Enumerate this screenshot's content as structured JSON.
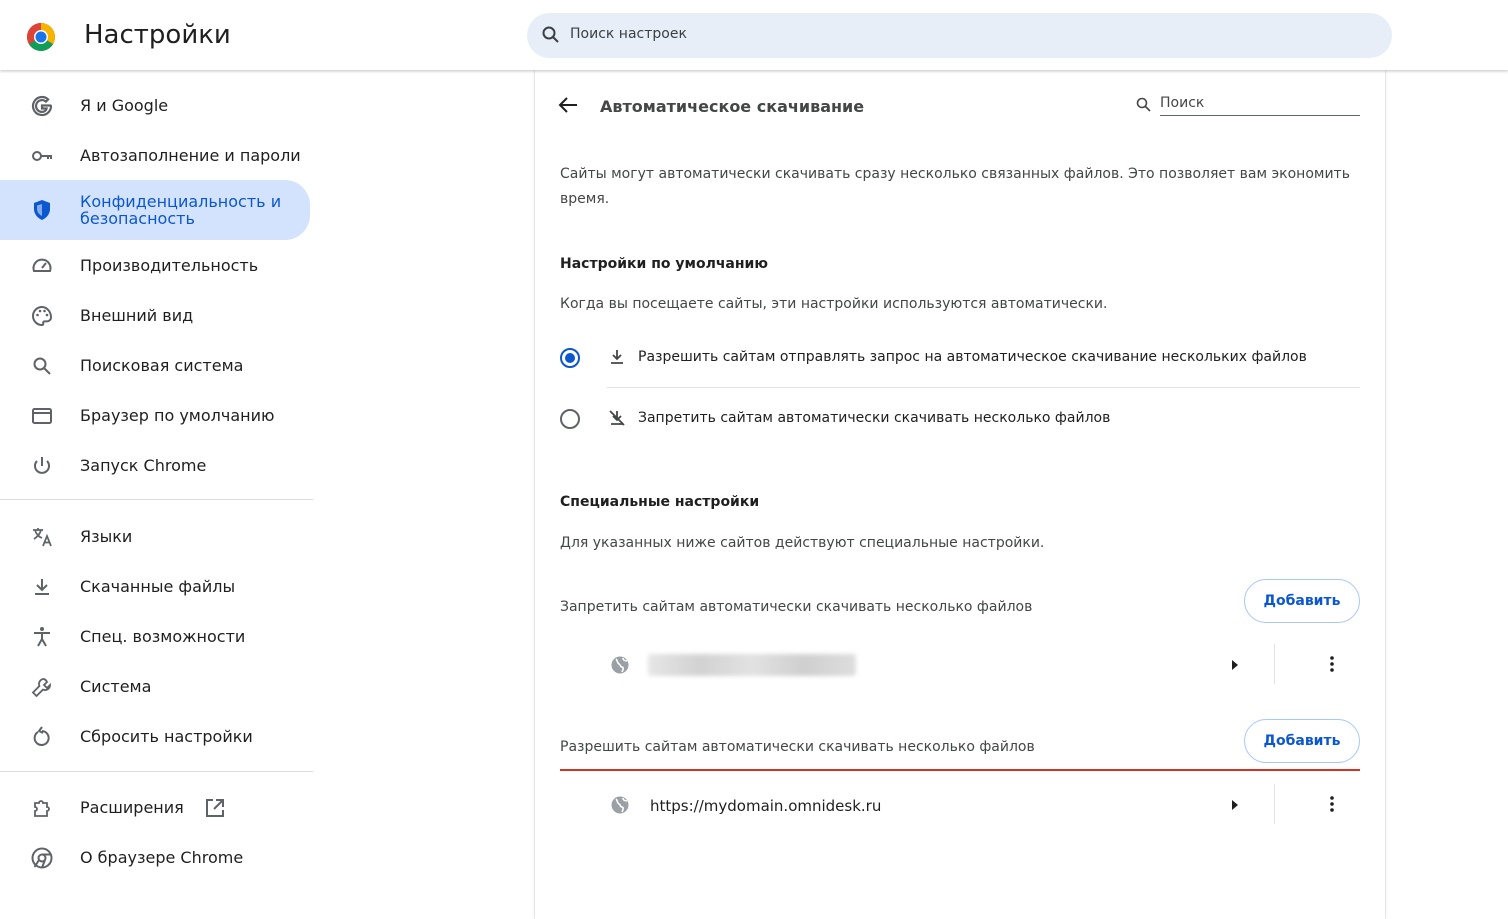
{
  "header": {
    "title": "Настройки",
    "search_placeholder": "Поиск настроек"
  },
  "sidebar": {
    "items": [
      {
        "label": "Я и Google",
        "icon": "google-icon"
      },
      {
        "label": "Автозаполнение и пароли",
        "icon": "key-icon"
      },
      {
        "label": "Конфиденциальность и безопасность",
        "icon": "shield-icon",
        "active": true
      },
      {
        "label": "Производительность",
        "icon": "speedometer-icon"
      },
      {
        "label": "Внешний вид",
        "icon": "palette-icon"
      },
      {
        "label": "Поисковая система",
        "icon": "search-icon"
      },
      {
        "label": "Браузер по умолчанию",
        "icon": "browser-window-icon"
      },
      {
        "label": "Запуск Chrome",
        "icon": "power-icon"
      },
      {
        "label": "Языки",
        "icon": "translate-icon"
      },
      {
        "label": "Скачанные файлы",
        "icon": "download-icon"
      },
      {
        "label": "Спец. возможности",
        "icon": "accessibility-icon"
      },
      {
        "label": "Система",
        "icon": "wrench-icon"
      },
      {
        "label": "Сбросить настройки",
        "icon": "reset-icon"
      },
      {
        "label": "Расширения",
        "icon": "puzzle-icon"
      },
      {
        "label": "О браузере Chrome",
        "icon": "chrome-icon"
      }
    ]
  },
  "page": {
    "title": "Автоматическое скачивание",
    "search_placeholder": "Поиск",
    "description": "Сайты могут автоматически скачивать сразу несколько связанных файлов. Это позволяет вам экономить время.",
    "default_heading": "Настройки по умолчанию",
    "default_sub": "Когда вы посещаете сайты, эти настройки используются автоматически.",
    "options": [
      {
        "label": "Разрешить сайтам отправлять запрос на автоматическое скачивание нескольких файлов",
        "checked": true
      },
      {
        "label": "Запретить сайтам автоматически скачивать несколько файлов",
        "checked": false
      }
    ],
    "custom_heading": "Специальные настройки",
    "custom_sub": "Для указанных ниже сайтов действуют специальные настройки.",
    "block_list": {
      "title": "Запретить сайтам автоматически скачивать несколько файлов",
      "add_label": "Добавить"
    },
    "allow_list": {
      "title": "Разрешить сайтам автоматически скачивать несколько файлов",
      "add_label": "Добавить",
      "sites": [
        "https://mydomain.omnidesk.ru"
      ]
    }
  },
  "colors": {
    "accent": "#0b57d0",
    "active_bg": "#d3e3fd",
    "highlight_line": "#d93025"
  }
}
